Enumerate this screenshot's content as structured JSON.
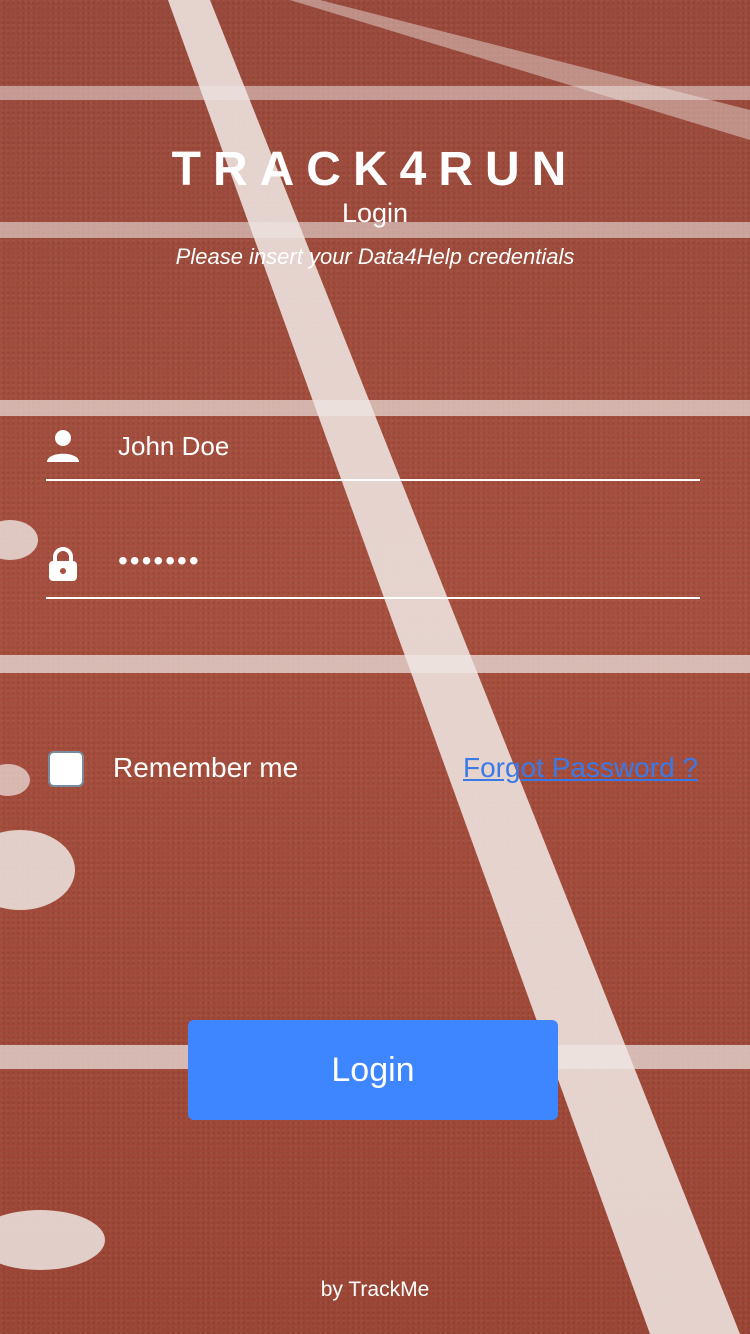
{
  "header": {
    "app_title": "TRACK4RUN",
    "screen_title": "Login",
    "instruction": "Please insert your Data4Help credentials"
  },
  "form": {
    "username_value": "John Doe",
    "password_value": "•••••••",
    "remember_label": "Remember me",
    "remember_checked": false,
    "forgot_link": "Forgot Password ?",
    "login_button": "Login"
  },
  "footer": {
    "text": "by TrackMe"
  },
  "colors": {
    "button": "#3d86ff",
    "link": "#3b7ae6",
    "track": "#a8503f"
  },
  "icons": {
    "username": "user-icon",
    "password": "lock-icon"
  }
}
